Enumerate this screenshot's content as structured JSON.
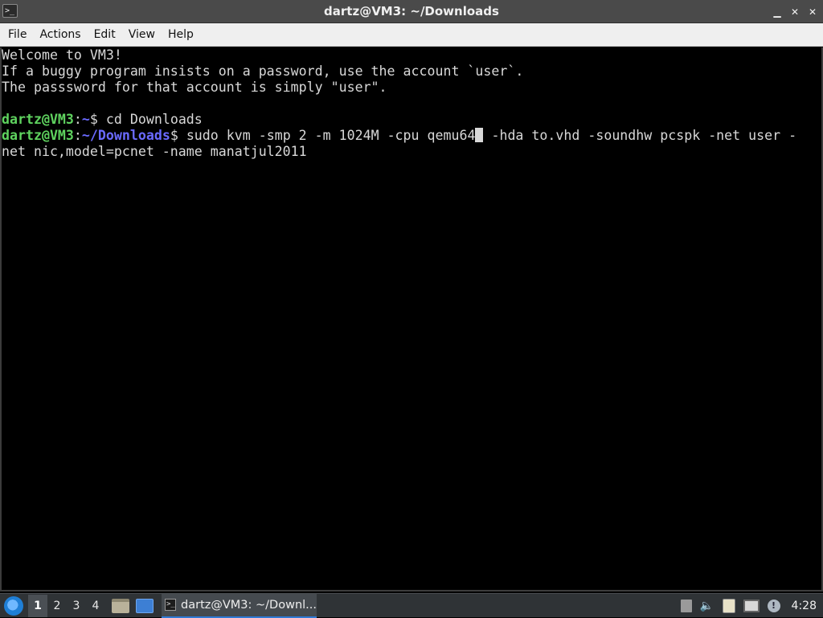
{
  "window": {
    "title": "dartz@VM3: ~/Downloads",
    "app_icon_glyph": ">_",
    "controls": {
      "minimize": "▁",
      "maximize": "✕",
      "close": "✕"
    }
  },
  "menu": {
    "items": [
      "File",
      "Actions",
      "Edit",
      "View",
      "Help"
    ]
  },
  "terminal": {
    "motd": [
      "Welcome to VM3!",
      "If a buggy program insists on a password, use the account `user`.",
      "The passsword for that account is simply \"user\"."
    ],
    "prompt1": {
      "user": "dartz@VM3",
      "sep": ":",
      "path": "~",
      "symbol": "$ ",
      "command": "cd Downloads"
    },
    "prompt2": {
      "user": "dartz@VM3",
      "sep": ":",
      "path": "~/Downloads",
      "symbol": "$ ",
      "command_before_cursor": "sudo kvm -smp 2 -m 1024M -cpu qemu64",
      "command_after_cursor": " -hda to.vhd -soundhw pcspk -net user -",
      "command_wrap": "net nic,model=pcnet -name manatjul2011"
    }
  },
  "taskbar": {
    "workspaces": [
      "1",
      "2",
      "3",
      "4"
    ],
    "active_workspace": "1",
    "task_label": "dartz@VM3: ~/Downl...",
    "clock": "4:28",
    "icons": [
      "start-menu-icon",
      "file-manager-icon",
      "show-desktop-icon",
      "terminal-icon",
      "eject-icon",
      "volume-icon",
      "clipboard-icon",
      "network-icon",
      "update-notifier-icon"
    ]
  },
  "colors": {
    "user": "#5fd35f",
    "path": "#6a6aff",
    "terminal_bg": "#000000",
    "terminal_fg": "#d8d8d8",
    "titlebar": "#4a4a4a",
    "menubar": "#efefef",
    "taskbar": "#2f3336"
  }
}
